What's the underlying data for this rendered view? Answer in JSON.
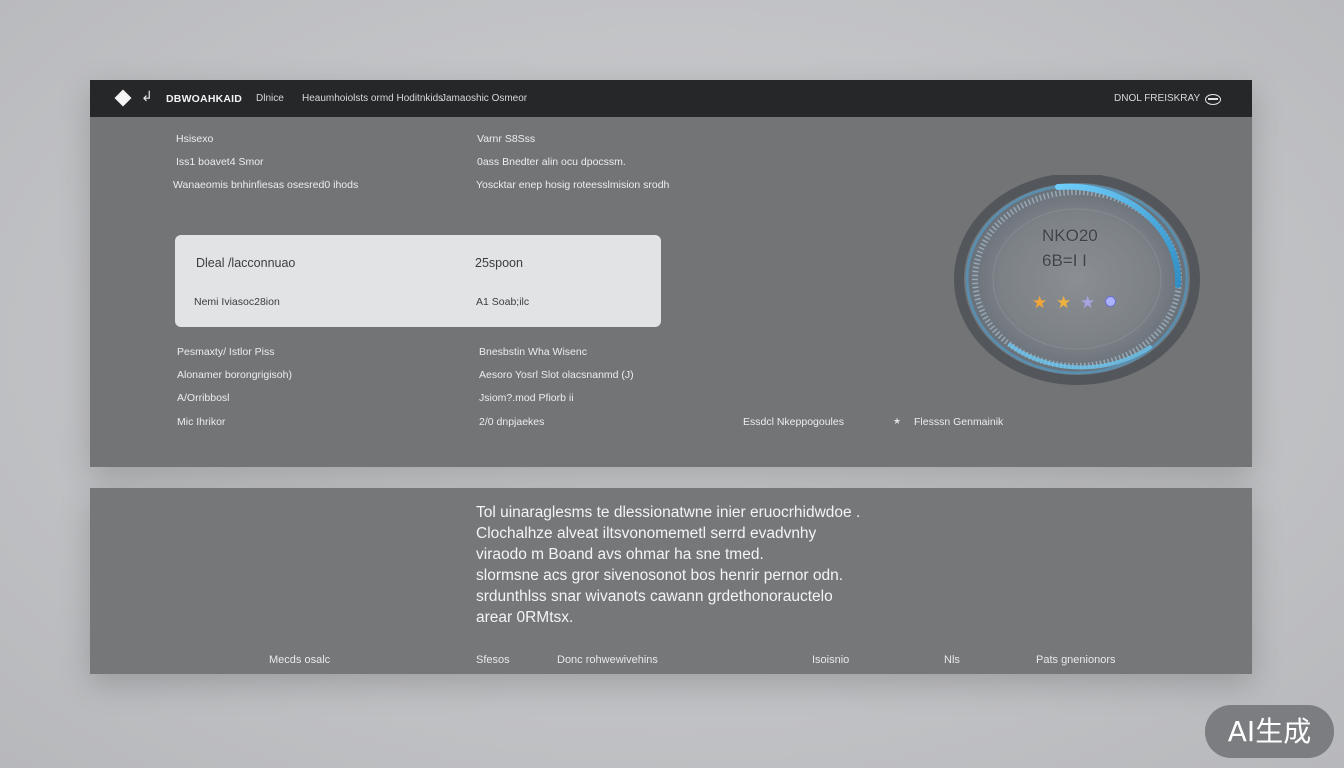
{
  "titlebar": {
    "brand": "DBWOAHKAID",
    "item1": "Dlnice",
    "item2": "Heaumhoiolsts ormd Hoditnkids",
    "item3": "Jamaoshic Osmeor",
    "right_label": "DNOL FREISKRAY"
  },
  "top_info": {
    "left": [
      "Hsisexo",
      "Iss1 boavet4 Smor",
      "Wanaeomis bnhinfiesas osesred0 ihods"
    ],
    "right": [
      "Varnr S8Sss",
      "0ass Bnedter alin ocu dpocssm.",
      "Yoscktar enep hosig roteesslmision srodh"
    ]
  },
  "card": {
    "row1_left": "Dleal /lacconnuao",
    "row1_right": "25spoon",
    "row2_left": "Nemi Iviasoc28ion",
    "row2_right": "A1 Soab;ilc"
  },
  "lower_info": {
    "left": [
      "Pesmaxty/ Istlor Piss",
      "Alonamer borongrigisoh)",
      "A/Orribbosl",
      "Mic Ihrikor"
    ],
    "right": [
      "Bnesbstin Wha Wisenc",
      "Aesoro Yosrl Slot olacsnanmd (J)",
      "Jsiom?.mod Pfiorb ii",
      "2/0 dnpjaekes"
    ]
  },
  "status": {
    "left": "Essdcl Nkeppogoules",
    "right": "Flesssn Genmainik",
    "right_icon": "star-icon"
  },
  "dial": {
    "line1": "NKO20",
    "line2": "6B=I I",
    "rating": 3,
    "accent": "#4fb6e4"
  },
  "description": [
    "Tol uinaraglesms te dlessionatwne inier eruocrhidwdoe .",
    "Clochalhze alveat iltsvonomemetl serrd evadvnhy",
    "viraodo m Boand avs ohmar ha sne tmed.",
    "slormsne acs gror sivenosonot bos henrir pernor odn.",
    "srdunthlss snar wivanots cawann grdethonorauctelo",
    "arear 0RMtsx."
  ],
  "footer": [
    "Mecds osalc",
    "Sfesos",
    "Donc rohwewivehins",
    "Isoisnio",
    "Nls",
    "Pats gnenionors"
  ],
  "watermark": "AI生成"
}
